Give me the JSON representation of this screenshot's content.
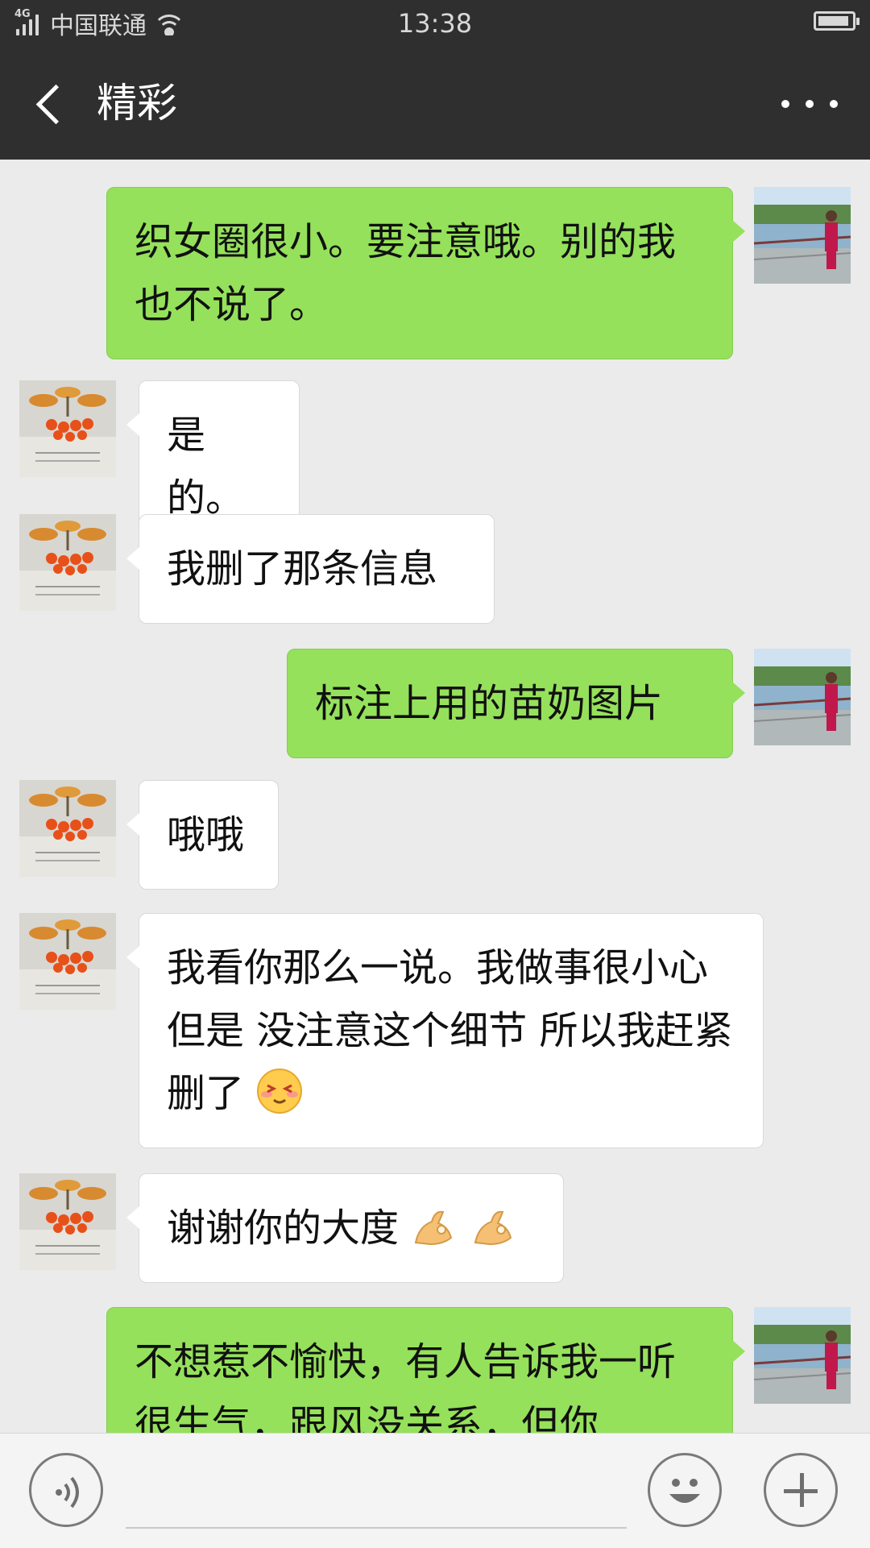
{
  "status_bar": {
    "network": "4G",
    "carrier": "中国联通",
    "time": "13:38"
  },
  "header": {
    "title": "精彩"
  },
  "messages": [
    {
      "side": "right",
      "text": "织女圈很小。要注意哦。别的我也不说了。"
    },
    {
      "side": "left",
      "text": "是的。"
    },
    {
      "side": "left",
      "text": "我删了那条信息"
    },
    {
      "side": "right",
      "text": "标注上用的苗奶图片"
    },
    {
      "side": "left",
      "text": "哦哦"
    },
    {
      "side": "left",
      "text": "我看你那么一说。我做事很小心 但是 没注意这个细节 所以我赶紧删了"
    },
    {
      "side": "left",
      "text": "谢谢你的大度"
    },
    {
      "side": "right",
      "text": "不想惹不愉快，有人告诉我一听很生气，跟风没关系，但你"
    }
  ],
  "icons": {
    "back": "chevron-left-icon",
    "more": "more-dots-icon",
    "voice": "voice-icon",
    "emoji": "smiley-icon",
    "plus": "plus-icon"
  },
  "colors": {
    "header_bg": "#2f2f30",
    "chat_bg": "#ebebeb",
    "outgoing_bubble": "#95e15b",
    "incoming_bubble": "#ffffff"
  }
}
